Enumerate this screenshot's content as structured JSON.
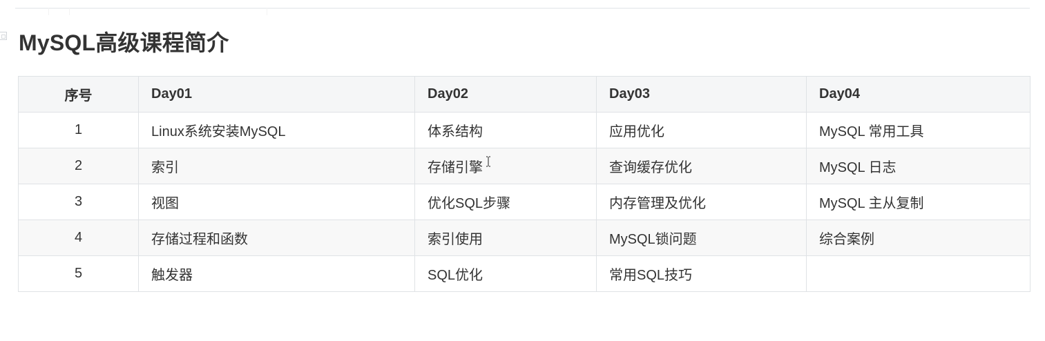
{
  "heading": "MySQL高级课程简介",
  "table": {
    "headers": [
      "序号",
      "Day01",
      "Day02",
      "Day03",
      "Day04"
    ],
    "rows": [
      [
        "1",
        "Linux系统安装MySQL",
        "体系结构",
        "应用优化",
        "MySQL 常用工具"
      ],
      [
        "2",
        "索引",
        "存储引擎",
        "查询缓存优化",
        "MySQL 日志"
      ],
      [
        "3",
        "视图",
        "优化SQL步骤",
        "内存管理及优化",
        "MySQL 主从复制"
      ],
      [
        "4",
        "存储过程和函数",
        "索引使用",
        "MySQL锁问题",
        "综合案例"
      ],
      [
        "5",
        "触发器",
        "SQL优化",
        "常用SQL技巧",
        ""
      ]
    ]
  },
  "icons": {
    "anchor": "anchor-icon",
    "cursor": "text-cursor-icon"
  }
}
